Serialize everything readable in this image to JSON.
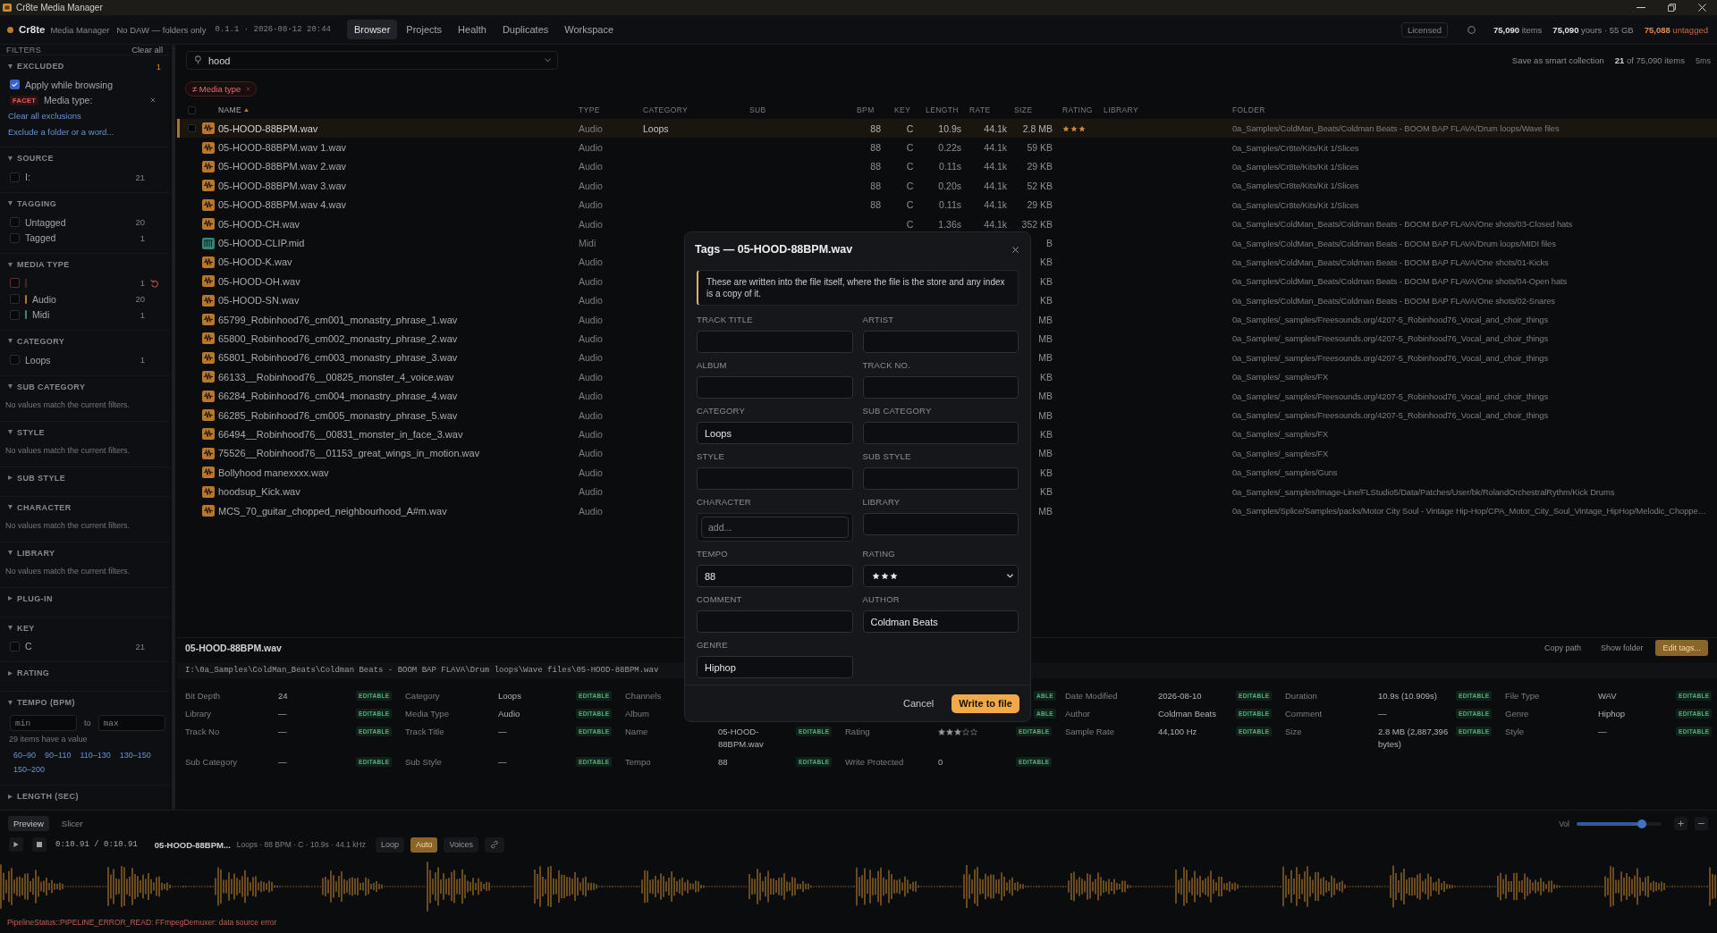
{
  "window": {
    "title": "Cr8te Media Manager"
  },
  "header": {
    "brand": "Cr8te",
    "subtitle": "Media Manager",
    "mode": "No DAW — folders only",
    "version": "0.1.1 · 2026-08-12 20:44",
    "tabs": [
      {
        "label": "Browser",
        "selected": true
      },
      {
        "label": "Projects",
        "selected": false
      },
      {
        "label": "Health",
        "selected": false
      },
      {
        "label": "Duplicates",
        "selected": false
      },
      {
        "label": "Workspace",
        "selected": false
      }
    ],
    "license": "Licensed",
    "stats": [
      {
        "text": "**75,090** items",
        "kind": "normal"
      },
      {
        "text": "**75,090** yours · 55 GB",
        "kind": "normal"
      },
      {
        "text": "**75,088** untagged",
        "kind": "warn"
      }
    ]
  },
  "filters": {
    "title": "FILTERS",
    "clear": "Clear all",
    "sections": [
      {
        "kind": "excluded",
        "title": "EXCLUDED",
        "expanded": true,
        "count": "1",
        "apply": {
          "label": "Apply while browsing",
          "checked": true
        },
        "facets": [
          {
            "tag": "FACET",
            "label": "Media type:"
          }
        ],
        "links": [
          "Clear all exclusions",
          "Exclude a folder or a word..."
        ]
      },
      {
        "kind": "list",
        "title": "SOURCE",
        "expanded": true,
        "items": [
          {
            "label": "I:",
            "count": "21",
            "checked": false,
            "excluded": false
          }
        ]
      },
      {
        "kind": "list",
        "title": "TAGGING",
        "expanded": true,
        "items": [
          {
            "label": "Untagged",
            "count": "20",
            "checked": false,
            "excluded": false
          },
          {
            "label": "Tagged",
            "count": "1",
            "checked": false,
            "excluded": false
          }
        ]
      },
      {
        "kind": "list",
        "title": "MEDIA TYPE",
        "expanded": true,
        "items": [
          {
            "count": "1",
            "checked": false,
            "excluded": true,
            "color": "#4a2626"
          },
          {
            "label": "Audio",
            "count": "20",
            "checked": false,
            "excluded": false,
            "color": "#b8772a"
          },
          {
            "label": "Midi",
            "count": "1",
            "checked": false,
            "excluded": false,
            "color": "#35897d"
          }
        ]
      },
      {
        "kind": "list",
        "title": "CATEGORY",
        "expanded": true,
        "items": [
          {
            "label": "Loops",
            "count": "1",
            "checked": false,
            "excluded": false
          }
        ]
      },
      {
        "kind": "empty",
        "title": "SUB CATEGORY",
        "expanded": true,
        "message": "No values match the current filters."
      },
      {
        "kind": "empty",
        "title": "STYLE",
        "expanded": true,
        "message": "No values match the current filters."
      },
      {
        "title": "SUB STYLE",
        "expanded": false
      },
      {
        "kind": "empty",
        "title": "CHARACTER",
        "expanded": true,
        "message": "No values match the current filters."
      },
      {
        "kind": "empty",
        "title": "LIBRARY",
        "expanded": true,
        "message": "No values match the current filters."
      },
      {
        "title": "PLUG-IN",
        "expanded": false
      },
      {
        "kind": "list",
        "title": "KEY",
        "expanded": true,
        "items": [
          {
            "label": "C",
            "count": "21",
            "checked": false,
            "excluded": false
          }
        ]
      },
      {
        "title": "RATING",
        "expanded": false
      },
      {
        "kind": "range",
        "title": "TEMPO (BPM)",
        "expanded": true,
        "min_placeholder": "min",
        "to": "to",
        "max_placeholder": "max",
        "hint": "29 items have a value",
        "presets": [
          "60–90",
          "90–110",
          "110–130",
          "130–150",
          "150–200"
        ]
      },
      {
        "title": "LENGTH (SEC)",
        "expanded": false
      }
    ]
  },
  "browser": {
    "search": {
      "value": "hood"
    },
    "save": "Save as smart collection",
    "result_count": "**21** of 75,090 items",
    "timing": "5ms",
    "chips": [
      {
        "label": "≠ Media type"
      }
    ],
    "select_all": {
      "checked": false
    },
    "columns": [
      {
        "label": "NAME",
        "sorted": true
      },
      {
        "label": "TYPE",
        "sorted": false
      },
      {
        "label": "CATEGORY",
        "sorted": false
      },
      {
        "label": "SUB",
        "sorted": false
      },
      {
        "label": "BPM",
        "sorted": false
      },
      {
        "label": "KEY",
        "sorted": false
      },
      {
        "label": "LENGTH",
        "sorted": false
      },
      {
        "label": "RATE",
        "sorted": false
      },
      {
        "label": "SIZE",
        "sorted": false
      },
      {
        "label": "RATING",
        "sorted": false
      },
      {
        "label": "LIBRARY",
        "sorted": false
      },
      {
        "label": "FOLDER",
        "sorted": false
      }
    ],
    "rows": [
      {
        "kind": "wav",
        "name": "05-HOOD-88BPM.wav",
        "type": "Audio",
        "category": "Loops",
        "bpm": "88",
        "key": "C",
        "length": "10.9s",
        "rate": "44.1k",
        "size": "2.8 MB",
        "stars": 3,
        "folder": "0a_Samples/ColdMan_Beats/Coldman Beats - BOOM BAP FLAVA/Drum loops/Wave files",
        "selected": true
      },
      {
        "kind": "wav",
        "name": "05-HOOD-88BPM.wav 1.wav",
        "type": "Audio",
        "bpm": "88",
        "key": "C",
        "length": "0.22s",
        "rate": "44.1k",
        "size": "59 KB",
        "folder": "0a_Samples/Cr8te/Kits/Kit 1/Slices",
        "selected": false
      },
      {
        "kind": "wav",
        "name": "05-HOOD-88BPM.wav 2.wav",
        "type": "Audio",
        "bpm": "88",
        "key": "C",
        "length": "0.11s",
        "rate": "44.1k",
        "size": "29 KB",
        "folder": "0a_Samples/Cr8te/Kits/Kit 1/Slices",
        "selected": false
      },
      {
        "kind": "wav",
        "name": "05-HOOD-88BPM.wav 3.wav",
        "type": "Audio",
        "bpm": "88",
        "key": "C",
        "length": "0.20s",
        "rate": "44.1k",
        "size": "52 KB",
        "folder": "0a_Samples/Cr8te/Kits/Kit 1/Slices",
        "selected": false
      },
      {
        "kind": "wav",
        "name": "05-HOOD-88BPM.wav 4.wav",
        "type": "Audio",
        "bpm": "88",
        "key": "C",
        "length": "0.11s",
        "rate": "44.1k",
        "size": "29 KB",
        "folder": "0a_Samples/Cr8te/Kits/Kit 1/Slices",
        "selected": false
      },
      {
        "kind": "wav",
        "name": "05-HOOD-CH.wav",
        "type": "Audio",
        "key": "C",
        "length": "1.36s",
        "rate": "44.1k",
        "size": "352 KB",
        "folder": "0a_Samples/ColdMan_Beats/Coldman Beats - BOOM BAP FLAVA/One shots/03-Closed hats",
        "selected": false
      },
      {
        "kind": "mid",
        "name": "05-HOOD-CLIP.mid",
        "type": "Midi",
        "size": "B",
        "folder": "0a_Samples/ColdMan_Beats/Coldman Beats - BOOM BAP FLAVA/Drum loops/MIDI files",
        "selected": false
      },
      {
        "kind": "wav",
        "name": "05-HOOD-K.wav",
        "type": "Audio",
        "size": "KB",
        "folder": "0a_Samples/ColdMan_Beats/Coldman Beats - BOOM BAP FLAVA/One shots/01-Kicks",
        "selected": false
      },
      {
        "kind": "wav",
        "name": "05-HOOD-OH.wav",
        "type": "Audio",
        "size": "KB",
        "folder": "0a_Samples/ColdMan_Beats/Coldman Beats - BOOM BAP FLAVA/One shots/04-Open hats",
        "selected": false
      },
      {
        "kind": "wav",
        "name": "05-HOOD-SN.wav",
        "type": "Audio",
        "size": "KB",
        "folder": "0a_Samples/ColdMan_Beats/Coldman Beats - BOOM BAP FLAVA/One shots/02-Snares",
        "selected": false
      },
      {
        "kind": "wav",
        "name": "65799_Robinhood76_cm001_monastry_phrase_1.wav",
        "type": "Audio",
        "size": "MB",
        "folder": "0a_Samples/_samples/Freesounds.org/4207-5_Robinhood76_Vocal_and_choir_things",
        "selected": false
      },
      {
        "kind": "wav",
        "name": "65800_Robinhood76_cm002_monastry_phrase_2.wav",
        "type": "Audio",
        "size": "MB",
        "folder": "0a_Samples/_samples/Freesounds.org/4207-5_Robinhood76_Vocal_and_choir_things",
        "selected": false
      },
      {
        "kind": "wav",
        "name": "65801_Robinhood76_cm003_monastry_phrase_3.wav",
        "type": "Audio",
        "size": "MB",
        "folder": "0a_Samples/_samples/Freesounds.org/4207-5_Robinhood76_Vocal_and_choir_things",
        "selected": false
      },
      {
        "kind": "wav",
        "name": "66133__Robinhood76__00825_monster_4_voice.wav",
        "type": "Audio",
        "size": "KB",
        "folder": "0a_Samples/_samples/FX",
        "selected": false
      },
      {
        "kind": "wav",
        "name": "66284_Robinhood76_cm004_monastry_phrase_4.wav",
        "type": "Audio",
        "size": "MB",
        "folder": "0a_Samples/_samples/Freesounds.org/4207-5_Robinhood76_Vocal_and_choir_things",
        "selected": false
      },
      {
        "kind": "wav",
        "name": "66285_Robinhood76_cm005_monastry_phrase_5.wav",
        "type": "Audio",
        "size": "MB",
        "folder": "0a_Samples/_samples/Freesounds.org/4207-5_Robinhood76_Vocal_and_choir_things",
        "selected": false
      },
      {
        "kind": "wav",
        "name": "66494__Robinhood76__00831_monster_in_face_3.wav",
        "type": "Audio",
        "size": "KB",
        "folder": "0a_Samples/_samples/FX",
        "selected": false
      },
      {
        "kind": "wav",
        "name": "75526__Robinhood76__01153_great_wings_in_motion.wav",
        "type": "Audio",
        "size": "MB",
        "folder": "0a_Samples/_samples/FX",
        "selected": false
      },
      {
        "kind": "wav",
        "name": "Bollyhood manexxxx.wav",
        "type": "Audio",
        "size": "KB",
        "folder": "0a_Samples/_samples/Guns",
        "selected": false
      },
      {
        "kind": "wav",
        "name": "hoodsup_Kick.wav",
        "type": "Audio",
        "size": "KB",
        "folder": "0a_Samples/_samples/Image-Line/FLStudio5/Data/Patches/User/bk/RolandOrchestralRythm/Kick Drums",
        "selected": false
      },
      {
        "kind": "wav",
        "name": "MCS_70_guitar_chopped_neighbourhood_A#m.wav",
        "type": "Audio",
        "size": "MB",
        "folder": "0a_Samples/Splice/Samples/packs/Motor City Soul - Vintage Hip-Hop/CPA_Motor_City_Soul_Vintage_HipHop/Melodic_Choppe…",
        "selected": false
      }
    ]
  },
  "details": {
    "title": "05-HOOD-88BPM.wav",
    "actions": [
      {
        "label": "Copy path",
        "kind": "copy"
      },
      {
        "label": "Show folder",
        "kind": "reveal"
      },
      {
        "label": "Edit tags...",
        "kind": "edit"
      }
    ],
    "path": "I:\\0a_Samples\\ColdMan_Beats\\Coldman Beats - BOOM BAP FLAVA\\Drum loops\\Wave files\\05-HOOD-88BPM.wav",
    "fields": [
      [
        {
          "label": "Bit Depth",
          "value": "24",
          "badge": "EDITABLE"
        },
        {
          "label": "Category",
          "value": "Loops",
          "badge": "EDITABLE"
        },
        {
          "label": "Channels"
        },
        {
          "badge": "ABLE"
        },
        {
          "label": "Date Modified",
          "value": "2026-08-10",
          "badge": "EDITABLE"
        },
        {
          "label": "Duration",
          "value": "10.9s (10.909s)",
          "badge": "EDITABLE"
        },
        {
          "label": "File Type",
          "value": "WAV",
          "badge": "EDITABLE"
        }
      ],
      [
        {
          "label": "Library",
          "value": "—",
          "badge": "EDITABLE"
        },
        {
          "label": "Media Type",
          "value": "Audio",
          "badge": "EDITABLE"
        },
        {
          "label": "Album"
        },
        {
          "badge": "ABLE"
        },
        {
          "label": "Author",
          "value": "Coldman Beats",
          "badge": "EDITABLE"
        },
        {
          "label": "Comment",
          "value": "—",
          "badge": "EDITABLE"
        },
        {
          "label": "Genre",
          "value": "Hiphop",
          "badge": "EDITABLE"
        }
      ],
      [
        {
          "label": "Track No",
          "value": "—",
          "badge": "EDITABLE"
        },
        {
          "label": "Track Title",
          "value": "—",
          "badge": "EDITABLE"
        },
        {
          "label": "Name",
          "value": "05-HOOD-88BPM.wav",
          "badge": "EDITABLE"
        },
        {
          "label": "Rating",
          "stars": 3,
          "badge": "EDITABLE"
        },
        {
          "label": "Sample Rate",
          "value": "44,100 Hz",
          "badge": "EDITABLE"
        },
        {
          "label": "Size",
          "value": "2.8 MB (2,887,396 bytes)",
          "badge": "EDITABLE"
        },
        {
          "label": "Style",
          "value": "—",
          "badge": "EDITABLE"
        }
      ],
      [
        {
          "label": "Sub Category",
          "value": "—",
          "badge": "EDITABLE"
        },
        {
          "label": "Sub Style",
          "value": "—",
          "badge": "EDITABLE"
        },
        {
          "label": "Tempo",
          "value": "88",
          "badge": "EDITABLE"
        },
        {
          "label": "Write Protected",
          "value": "0",
          "badge": "EDITABLE"
        }
      ]
    ]
  },
  "tag_dialog": {
    "title": "Tags — 05-HOOD-88BPM.wav",
    "note": "These are written into the file itself, where the file is the store and any index is a copy of it.",
    "fields": [
      {
        "label": "TRACK TITLE",
        "kind": "text"
      },
      {
        "label": "ARTIST",
        "kind": "text"
      },
      {
        "label": "ALBUM",
        "kind": "text"
      },
      {
        "label": "TRACK NO.",
        "kind": "text"
      },
      {
        "label": "CATEGORY",
        "kind": "text",
        "value": "Loops"
      },
      {
        "label": "SUB CATEGORY",
        "kind": "text"
      },
      {
        "label": "STYLE",
        "kind": "text"
      },
      {
        "label": "SUB STYLE",
        "kind": "text"
      },
      {
        "label": "CHARACTER",
        "kind": "tags",
        "placeholder": "add..."
      },
      {
        "label": "LIBRARY",
        "kind": "text"
      },
      {
        "label": "TEMPO",
        "kind": "text",
        "value": "88"
      },
      {
        "label": "RATING",
        "kind": "select",
        "stars": 3
      },
      {
        "label": "COMMENT",
        "kind": "text"
      },
      {
        "label": "AUTHOR",
        "kind": "text",
        "value": "Coldman Beats"
      },
      {
        "label": "GENRE",
        "kind": "text",
        "value": "Hiphop"
      }
    ],
    "buttons": [
      {
        "label": "Cancel",
        "kind": "cancel"
      },
      {
        "label": "Write to file",
        "kind": "confirm"
      }
    ]
  },
  "player": {
    "tabs": [
      {
        "label": "Preview",
        "selected": true
      },
      {
        "label": "Slicer",
        "selected": false
      }
    ],
    "volume": {
      "label": "Vol",
      "level": 0.77
    },
    "time": "0:10.91 / 0:10.91",
    "track": "05-HOOD-88BPM...",
    "meta": "Loops · 88 BPM · C · 10.9s · 44.1 kHz",
    "toggles": [
      {
        "label": "Loop",
        "on": false
      },
      {
        "label": "Auto",
        "on": true
      },
      {
        "label": "Voices",
        "on": false
      }
    ],
    "status": "PipelineStatus::PIPELINE_ERROR_READ: FFmpegDemuxer: data source error"
  }
}
